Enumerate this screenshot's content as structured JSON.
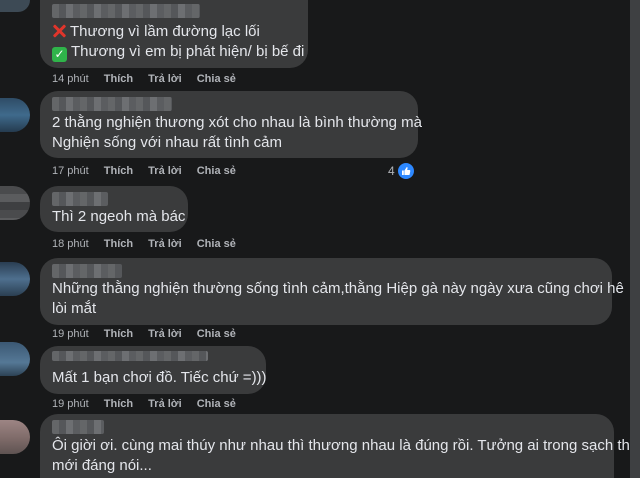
{
  "comments": [
    {
      "lines": [
        {
          "icon": "cross-mark-icon",
          "text": "Thương vì lầm đường lạc lối"
        },
        {
          "icon": "check-mark-icon",
          "text": "Thương vì em bị phát hiện/ bị bế đi"
        }
      ],
      "time": "14 phút"
    },
    {
      "lines": [
        {
          "text": "2 thằng nghiện thương xót cho nhau là bình thường mà"
        },
        {
          "text": "Nghiện sống với nhau rất tình cảm"
        }
      ],
      "time": "17 phút",
      "reaction_count": "4"
    },
    {
      "lines": [
        {
          "text": "Thì 2 ngeoh mà bác"
        }
      ],
      "time": "18 phút"
    },
    {
      "lines": [
        {
          "text": "Những thằng nghiện thường sống tình cảm,thằng Hiệp gà này ngày xưa cũng chơi hê"
        },
        {
          "text": "lòi mắt"
        }
      ],
      "time": "19 phút"
    },
    {
      "lines": [
        {
          "text": "Mất 1 bạn chơi đồ. Tiếc chứ =)))"
        }
      ],
      "time": "19 phút"
    },
    {
      "lines": [
        {
          "text": "Ôi giời ơi. cùng mai thúy như nhau thì thương nhau là đúng rồi. Tưởng ai trong sạch thì"
        },
        {
          "text": "mới đáng nói..."
        }
      ]
    }
  ],
  "actions": {
    "like": "Thích",
    "reply": "Trả lời",
    "share": "Chia sẻ"
  },
  "colors": {
    "background": "#18191a",
    "bubble": "#3a3b3c",
    "text": "#e4e6eb",
    "meta": "#b0b3b8",
    "like_blue": "#2d88ff"
  }
}
